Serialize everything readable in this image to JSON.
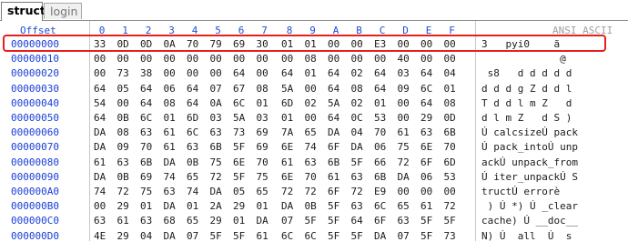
{
  "tabs": [
    {
      "label": "struct",
      "active": true
    },
    {
      "label": "login",
      "active": false
    }
  ],
  "header": {
    "offset_label": "Offset",
    "hex_columns": [
      "0",
      "1",
      "2",
      "3",
      "4",
      "5",
      "6",
      "7",
      "8",
      "9",
      "A",
      "B",
      "C",
      "D",
      "E",
      "F"
    ],
    "ansi_label": "ANSI ASCII"
  },
  "rows": [
    {
      "address": "00000000",
      "bytes": [
        "33",
        "0D",
        "0D",
        "0A",
        "70",
        "79",
        "69",
        "30",
        "01",
        "01",
        "00",
        "00",
        "E3",
        "00",
        "00",
        "00"
      ],
      "ascii": "3   pyi0    ã"
    },
    {
      "address": "00000010",
      "bytes": [
        "00",
        "00",
        "00",
        "00",
        "00",
        "00",
        "00",
        "00",
        "00",
        "08",
        "00",
        "00",
        "00",
        "40",
        "00",
        "00"
      ],
      "ascii": "             @"
    },
    {
      "address": "00000020",
      "bytes": [
        "00",
        "73",
        "38",
        "00",
        "00",
        "00",
        "64",
        "00",
        "64",
        "01",
        "64",
        "02",
        "64",
        "03",
        "64",
        "04"
      ],
      "ascii": " s8   d d d d d"
    },
    {
      "address": "00000030",
      "bytes": [
        "64",
        "05",
        "64",
        "06",
        "64",
        "07",
        "67",
        "08",
        "5A",
        "00",
        "64",
        "08",
        "64",
        "09",
        "6C",
        "01"
      ],
      "ascii": "d d d g Z d d l"
    },
    {
      "address": "00000040",
      "bytes": [
        "54",
        "00",
        "64",
        "08",
        "64",
        "0A",
        "6C",
        "01",
        "6D",
        "02",
        "5A",
        "02",
        "01",
        "00",
        "64",
        "08"
      ],
      "ascii": "T d d l m Z   d"
    },
    {
      "address": "00000050",
      "bytes": [
        "64",
        "0B",
        "6C",
        "01",
        "6D",
        "03",
        "5A",
        "03",
        "01",
        "00",
        "64",
        "0C",
        "53",
        "00",
        "29",
        "0D"
      ],
      "ascii": "d l m Z   d S )"
    },
    {
      "address": "00000060",
      "bytes": [
        "DA",
        "08",
        "63",
        "61",
        "6C",
        "63",
        "73",
        "69",
        "7A",
        "65",
        "DA",
        "04",
        "70",
        "61",
        "63",
        "6B"
      ],
      "ascii": "Ú calcsizeÚ pack"
    },
    {
      "address": "00000070",
      "bytes": [
        "DA",
        "09",
        "70",
        "61",
        "63",
        "6B",
        "5F",
        "69",
        "6E",
        "74",
        "6F",
        "DA",
        "06",
        "75",
        "6E",
        "70"
      ],
      "ascii": "Ú pack_intoÚ unp"
    },
    {
      "address": "00000080",
      "bytes": [
        "61",
        "63",
        "6B",
        "DA",
        "0B",
        "75",
        "6E",
        "70",
        "61",
        "63",
        "6B",
        "5F",
        "66",
        "72",
        "6F",
        "6D"
      ],
      "ascii": "ackÚ unpack_from"
    },
    {
      "address": "00000090",
      "bytes": [
        "DA",
        "0B",
        "69",
        "74",
        "65",
        "72",
        "5F",
        "75",
        "6E",
        "70",
        "61",
        "63",
        "6B",
        "DA",
        "06",
        "53"
      ],
      "ascii": "Ú iter_unpackÚ S"
    },
    {
      "address": "000000A0",
      "bytes": [
        "74",
        "72",
        "75",
        "63",
        "74",
        "DA",
        "05",
        "65",
        "72",
        "72",
        "6F",
        "72",
        "E9",
        "00",
        "00",
        "00"
      ],
      "ascii": "tructÚ errorè"
    },
    {
      "address": "000000B0",
      "bytes": [
        "00",
        "29",
        "01",
        "DA",
        "01",
        "2A",
        "29",
        "01",
        "DA",
        "0B",
        "5F",
        "63",
        "6C",
        "65",
        "61",
        "72"
      ],
      "ascii": " ) Ú *) Ú _clear"
    },
    {
      "address": "000000C0",
      "bytes": [
        "63",
        "61",
        "63",
        "68",
        "65",
        "29",
        "01",
        "DA",
        "07",
        "5F",
        "5F",
        "64",
        "6F",
        "63",
        "5F",
        "5F"
      ],
      "ascii": "cache) Ú __doc__"
    },
    {
      "address": "000000D0",
      "bytes": [
        "4E",
        "29",
        "04",
        "DA",
        "07",
        "5F",
        "5F",
        "61",
        "6C",
        "6C",
        "5F",
        "5F",
        "DA",
        "07",
        "5F",
        "73"
      ],
      "ascii": "N) Ú  all  Ú  s"
    }
  ]
}
